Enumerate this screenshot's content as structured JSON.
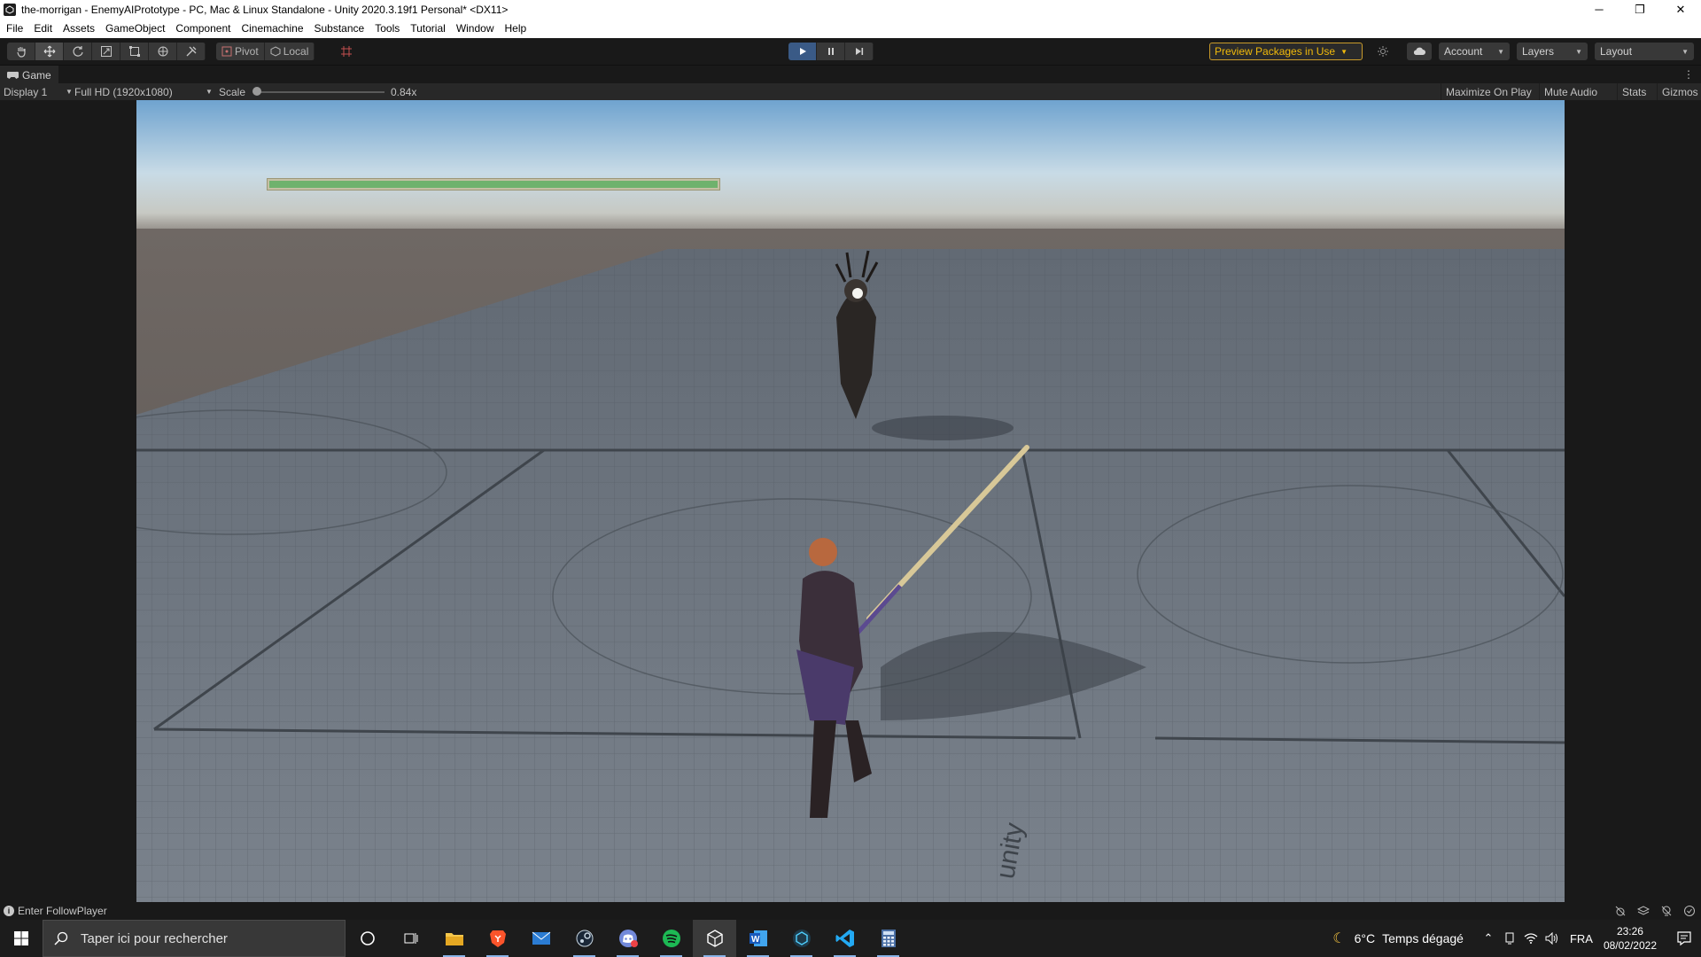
{
  "window": {
    "title": "the-morrigan - EnemyAIPrototype - PC, Mac & Linux Standalone - Unity 2020.3.19f1 Personal* <DX11>",
    "minimize_icon": "minimize-icon",
    "maximize_icon": "restore-icon",
    "close_icon": "close-icon"
  },
  "menu": {
    "items": [
      "File",
      "Edit",
      "Assets",
      "GameObject",
      "Component",
      "Cinemachine",
      "Substance",
      "Tools",
      "Tutorial",
      "Window",
      "Help"
    ]
  },
  "toolbar": {
    "tools": [
      "hand-tool-icon",
      "move-tool-icon",
      "rotate-tool-icon",
      "scale-tool-icon",
      "rect-tool-icon",
      "transform-tool-icon",
      "custom-tool-icon"
    ],
    "pivot_label": "Pivot",
    "local_label": "Local",
    "preview_packages_label": "Preview Packages in Use",
    "account_label": "Account",
    "layers_label": "Layers",
    "layout_label": "Layout",
    "play_state": "playing",
    "accent_color": "#3a5a86",
    "warning_color": "#f0b90b"
  },
  "game_view": {
    "tab_label": "Game",
    "display_label": "Display 1",
    "resolution_label": "Full HD (1920x1080)",
    "scale_label": "Scale",
    "scale_value": "0.84x",
    "scale_slider_fraction": 0.0,
    "maximize_label": "Maximize On Play",
    "mute_label": "Mute Audio",
    "stats_label": "Stats",
    "gizmos_label": "Gizmos",
    "health_bar_fraction": 1.0,
    "health_color": "#6fb26d"
  },
  "status": {
    "message": "Enter FollowPlayer"
  },
  "taskbar": {
    "search_placeholder": "Taper ici pour rechercher",
    "apps": [
      "cortana-icon",
      "task-view-icon",
      "file-explorer-icon",
      "brave-browser-icon",
      "mail-icon",
      "steam-icon",
      "discord-icon",
      "spotify-icon",
      "unity-icon",
      "word-icon",
      "unity-hub-icon",
      "vscode-icon",
      "calculator-icon"
    ],
    "weather_temp": "6°C",
    "weather_desc": "Temps dégagé",
    "language": "FRA",
    "time": "23:26",
    "date": "08/02/2022"
  }
}
